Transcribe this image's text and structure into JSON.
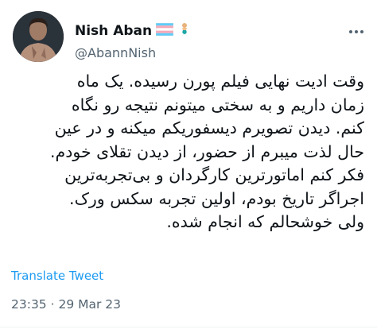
{
  "author": {
    "display_name": "Nish Aban",
    "handle": "@AbannNish",
    "badges": [
      "transgender-flag-icon",
      "mermaid-icon"
    ]
  },
  "tweet": {
    "lines": [
      "وقت ادیت نهایی فیلم پورن رسیده. یک ماه",
      "زمان داریم و به سختی میتونم نتیجه رو نگاه",
      "کنم. دیدن تصویرم دیسفوریکم میکنه و در عین",
      "حال لذت میبرم از حضور، از دیدن تقلای خودم.",
      "فکر کنم اماتورترین کارگردان و بی‌تجربه‌ترین",
      "اجراگر تاریخ بودم، اولین تجربه سکس ورک.",
      "ولی خوشحالم که انجام شده."
    ],
    "translate_label": "Translate Tweet",
    "time": "23:35",
    "separator": "·",
    "date": "29 Mar 23"
  },
  "colors": {
    "text": "#0f1419",
    "secondary": "#536471",
    "link": "#1d9bf0"
  }
}
